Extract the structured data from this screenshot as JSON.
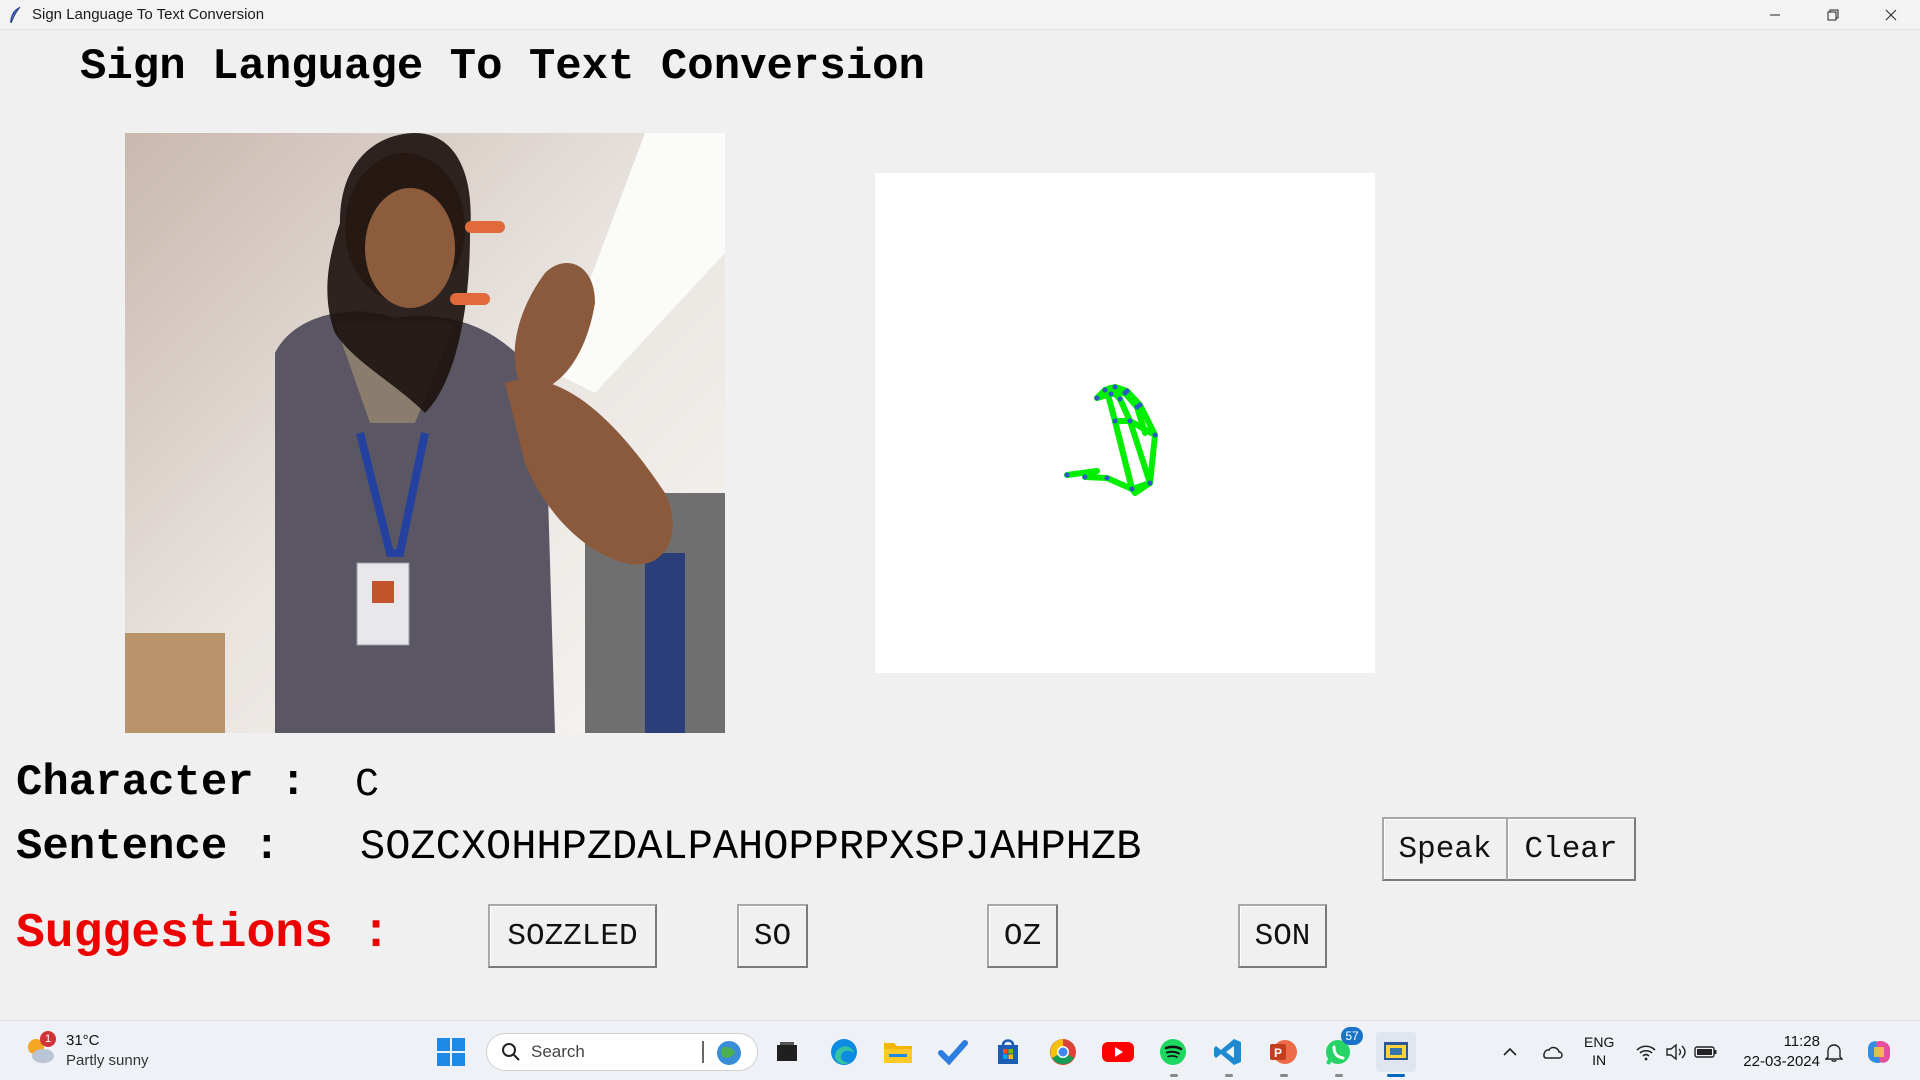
{
  "window": {
    "title": "Sign Language To Text Conversion"
  },
  "app": {
    "heading": "Sign Language To Text Conversion",
    "character_label": "Character :",
    "character_value": "C",
    "sentence_label": "Sentence :",
    "sentence_value": "SOZCXOHHPZDALPAHOPPRPXSPJAHPHZB",
    "speak_button": "Speak",
    "clear_button": "Clear",
    "suggestions_label": "Suggestions :",
    "suggestions": [
      "SOZZLED",
      "SO",
      "OZ",
      "SON"
    ],
    "colors": {
      "suggestions_label": "#ee0000",
      "skeleton": "#00ee00"
    }
  },
  "taskbar": {
    "weather_temp": "31°C",
    "weather_condition": "Partly sunny",
    "weather_badge": "1",
    "search_placeholder": "Search",
    "whatsapp_badge": "57",
    "language_line1": "ENG",
    "language_line2": "IN",
    "time": "11:28",
    "date": "22-03-2024",
    "pinned_apps": [
      "widgets-icon",
      "task-view-icon",
      "edge-icon",
      "file-explorer-icon",
      "todo-icon",
      "store-icon",
      "chrome-icon",
      "youtube-icon",
      "spotify-icon",
      "vscode-icon",
      "powerpoint-icon",
      "whatsapp-icon",
      "python-icon"
    ]
  }
}
